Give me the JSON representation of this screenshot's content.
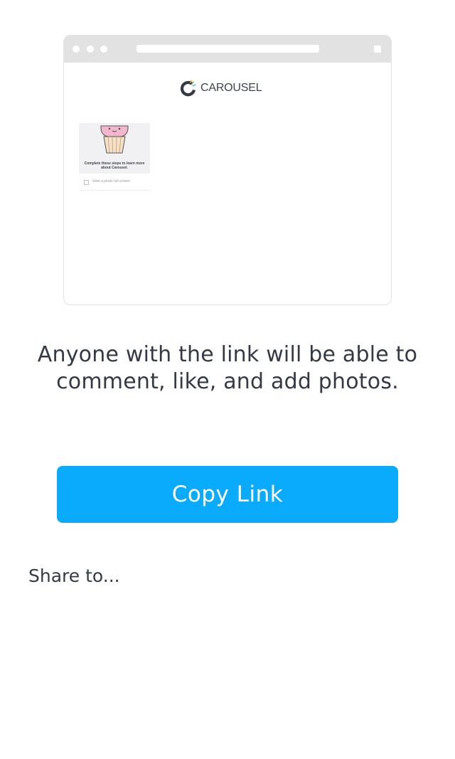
{
  "preview": {
    "brand_name": "CAROUSEL",
    "card_text": "Complete these steps to learn more about Carousel.",
    "checklist_item": "View a photo full screen"
  },
  "share_message": "Anyone with the link will be able to comment, like, and add photos.",
  "copy_button_label": "Copy Link",
  "share_to_label": "Share to...",
  "colors": {
    "primary": "#0aaafc",
    "text": "#333a45",
    "browser_chrome": "#e2e2e2"
  },
  "icons": [
    "carousel-logo-icon",
    "cupcake-illustration",
    "checkbox-icon"
  ]
}
